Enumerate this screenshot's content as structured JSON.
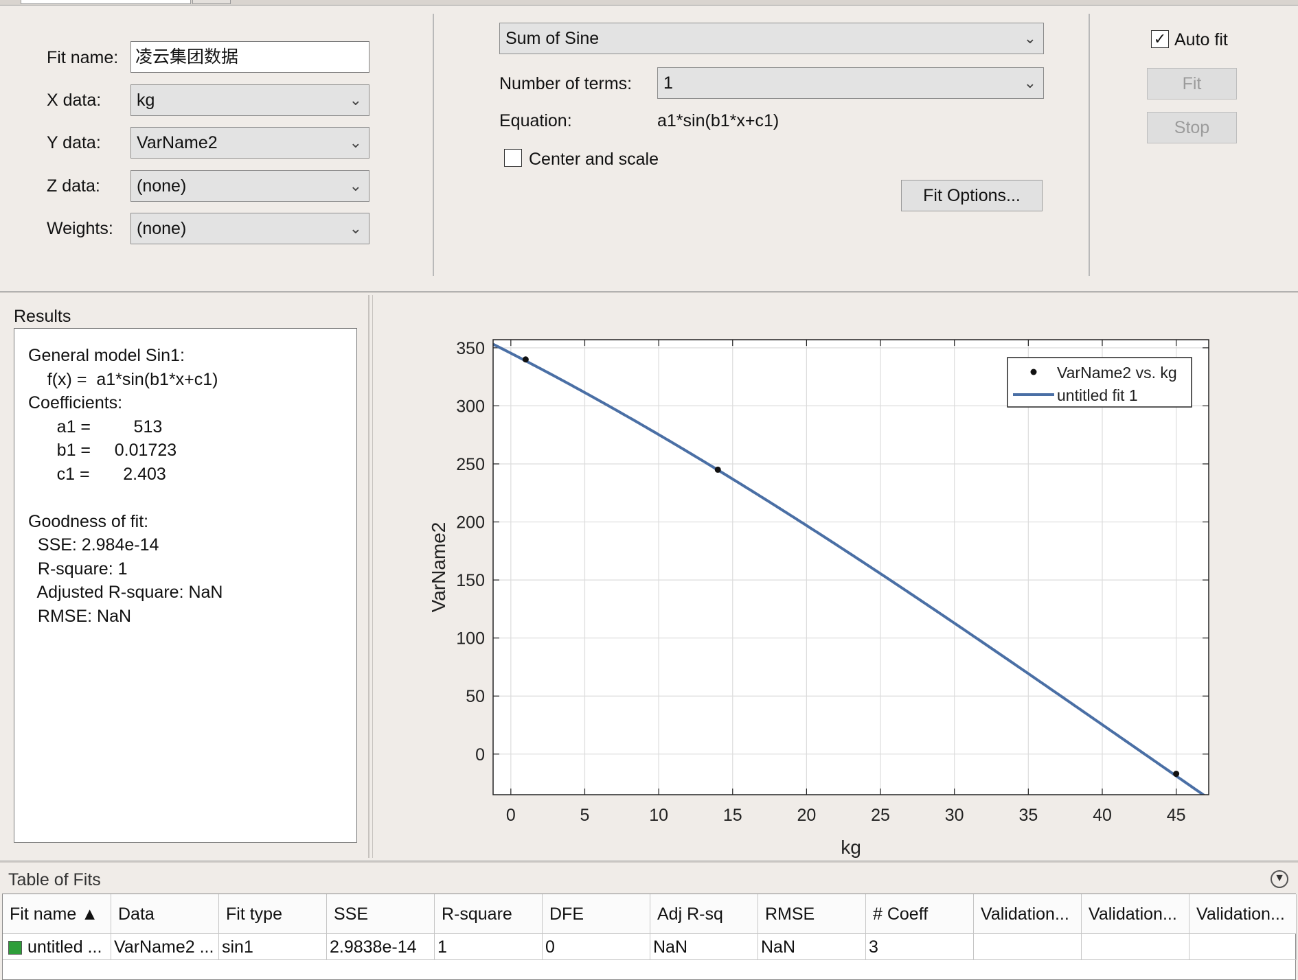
{
  "fit_setup": {
    "fit_name_label": "Fit name:",
    "fit_name_value": "凌云集团数据",
    "x_data_label": "X data:",
    "x_data_value": "kg",
    "y_data_label": "Y data:",
    "y_data_value": "VarName2",
    "z_data_label": "Z data:",
    "z_data_value": "(none)",
    "weights_label": "Weights:",
    "weights_value": "(none)"
  },
  "model": {
    "type_value": "Sum of Sine",
    "terms_label": "Number of terms:",
    "terms_value": "1",
    "equation_label": "Equation:",
    "equation_value": "a1*sin(b1*x+c1)",
    "center_scale_label": "Center and scale",
    "center_scale_checked": false,
    "fit_options_label": "Fit Options..."
  },
  "controls": {
    "auto_fit_label": "Auto fit",
    "auto_fit_checked": true,
    "fit_label": "Fit",
    "stop_label": "Stop"
  },
  "results": {
    "title": "Results",
    "lines": [
      "General model Sin1:",
      "    f(x) =  a1*sin(b1*x+c1)",
      "Coefficients:",
      "      a1 =         513",
      "      b1 =     0.01723",
      "      c1 =       2.403",
      "",
      "Goodness of fit:",
      "  SSE: 2.984e-14",
      "  R-square: 1",
      "  Adjusted R-square: NaN",
      "  RMSE: NaN"
    ]
  },
  "chart_data": {
    "type": "scatter",
    "title": "",
    "xlabel": "kg",
    "ylabel": "VarName2",
    "xlim": [
      -1.2,
      47.2
    ],
    "ylim": [
      -35,
      357
    ],
    "xticks": [
      0,
      5,
      10,
      15,
      20,
      25,
      30,
      35,
      40,
      45
    ],
    "yticks": [
      0,
      50,
      100,
      150,
      200,
      250,
      300,
      350
    ],
    "grid": true,
    "legend_position": "top-right",
    "series": [
      {
        "name": "VarName2 vs. kg",
        "kind": "points",
        "color": "#111111",
        "x": [
          1,
          14,
          45
        ],
        "y": [
          340,
          245,
          -17
        ]
      },
      {
        "name": "untitled fit 1",
        "kind": "curve",
        "color": "#4a6fa5",
        "a1": 513,
        "b1": 0.01723,
        "c1": 2.403
      }
    ]
  },
  "table_of_fits": {
    "title": "Table of Fits",
    "columns": [
      "Fit name ▲",
      "Data",
      "Fit type",
      "SSE",
      "R-square",
      "DFE",
      "Adj R-sq",
      "RMSE",
      "# Coeff",
      "Validation...",
      "Validation...",
      "Validation..."
    ],
    "rows": [
      {
        "color": "#2e9e3a",
        "cells": [
          "untitled ...",
          "VarName2 ...",
          "sin1",
          "2.9838e-14",
          "1",
          "0",
          "NaN",
          "NaN",
          "3",
          "",
          "",
          ""
        ]
      }
    ]
  }
}
